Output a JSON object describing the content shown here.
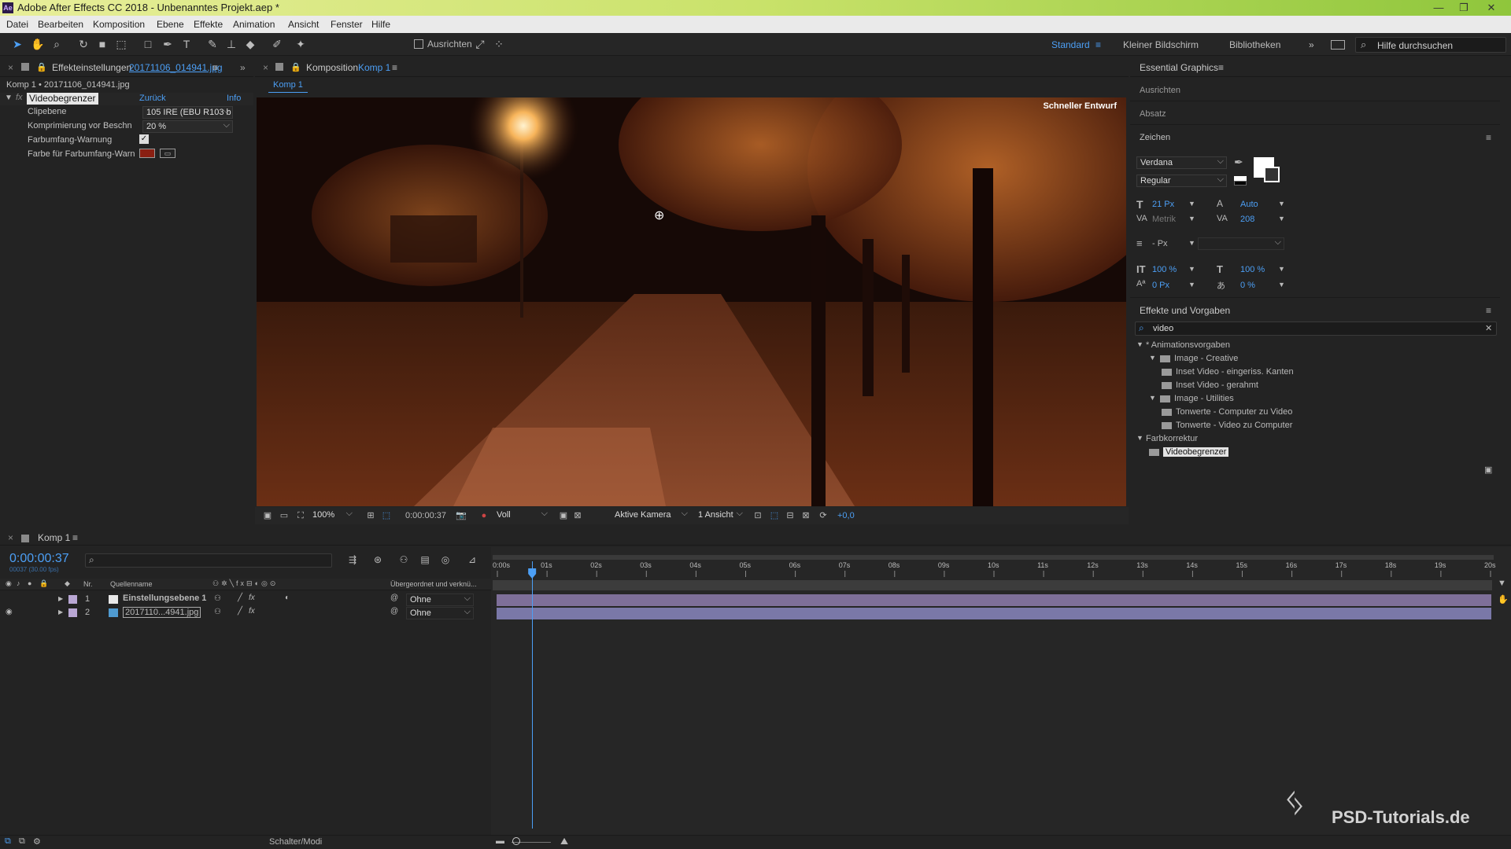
{
  "window": {
    "title": "Adobe After Effects CC 2018 - Unbenanntes Projekt.aep *",
    "app_badge": "Ae",
    "minimize": "—",
    "maximize": "❐",
    "close": "✕"
  },
  "menu": [
    "Datei",
    "Bearbeiten",
    "Komposition",
    "Ebene",
    "Effekte",
    "Animation",
    "Ansicht",
    "Fenster",
    "Hilfe"
  ],
  "toolbar": {
    "align_label": "Ausrichten",
    "workspaces": [
      "Standard",
      "Kleiner Bildschirm",
      "Bibliotheken"
    ],
    "active_workspace": "Standard",
    "more": "»",
    "help_search_placeholder": "Hilfe durchsuchen"
  },
  "effect_controls": {
    "tab_label": "Effekteinstellungen",
    "tab_file": "20171106_014941.jpg",
    "layer_path": "Komp 1 • 20171106_014941.jpg",
    "effect_name": "Videobegrenzer",
    "reset": "Zurück",
    "info": "Info",
    "props": [
      {
        "label": "Clipebene",
        "value": "105 IRE (EBU R103 b"
      },
      {
        "label": "Komprimierung vor Beschn",
        "value": "20 %"
      },
      {
        "label": "Farbumfang-Warnung",
        "value": "✓"
      },
      {
        "label": "Farbe für Farbumfang-Warn",
        "value": ""
      }
    ],
    "warn_color": "#8a1f12"
  },
  "composition": {
    "tab_label": "Komposition",
    "tab_comp": "Komp 1",
    "crumb": "Komp 1",
    "draft_label": "Schneller Entwurf",
    "zoom": "100%",
    "timecode": "0:00:00:37",
    "resolution": "Voll",
    "camera": "Aktive Kamera",
    "views": "1 Ansicht",
    "exposure": "+0,0"
  },
  "essential_graphics": {
    "title": "Essential Graphics",
    "sections": [
      "Ausrichten",
      "Absatz",
      "Zeichen"
    ]
  },
  "character": {
    "font": "Verdana",
    "style": "Regular",
    "size": "21 Px",
    "leading": "Auto",
    "kerning": "Metrik",
    "tracking": "208",
    "line_unit": "- Px",
    "vscale": "100 %",
    "hscale": "100 %",
    "baseline": "0 Px",
    "tsume": "0 %"
  },
  "effects_presets": {
    "title": "Effekte und Vorgaben",
    "search": "video",
    "tree": [
      {
        "label": "* Animationsvorgaben",
        "level": 0,
        "kind": "group"
      },
      {
        "label": "Image - Creative",
        "level": 1,
        "kind": "folder"
      },
      {
        "label": "Inset Video - eingeriss. Kanten",
        "level": 2,
        "kind": "item"
      },
      {
        "label": "Inset Video - gerahmt",
        "level": 2,
        "kind": "item"
      },
      {
        "label": "Image - Utilities",
        "level": 1,
        "kind": "folder"
      },
      {
        "label": "Tonwerte - Computer zu Video",
        "level": 2,
        "kind": "item"
      },
      {
        "label": "Tonwerte - Video zu Computer",
        "level": 2,
        "kind": "item"
      },
      {
        "label": "Farbkorrektur",
        "level": 0,
        "kind": "group"
      },
      {
        "label": "Videobegrenzer",
        "level": 1,
        "kind": "selected"
      }
    ]
  },
  "timeline": {
    "tab": "Komp 1",
    "timecode": "0:00:00:37",
    "sub_timecode": "00037 (30.00 fps)",
    "col_nr": "Nr.",
    "col_source": "Quellenname",
    "col_parent": "Übergeordnet und verknü...",
    "layers": [
      {
        "nr": "1",
        "name": "Einstellungsebene 1",
        "parent": "Ohne",
        "color": "#e8e8e8"
      },
      {
        "nr": "2",
        "name": "2017110...4941.jpg",
        "parent": "Ohne",
        "color": "#4f9ad0"
      }
    ],
    "ruler": [
      "0:00s",
      "01s",
      "02s",
      "03s",
      "04s",
      "05s",
      "06s",
      "07s",
      "08s",
      "09s",
      "10s",
      "11s",
      "12s",
      "13s",
      "14s",
      "15s",
      "16s",
      "17s",
      "18s",
      "19s",
      "20s"
    ],
    "playhead_seconds": 0.7,
    "switch_modes": "Schalter/Modi"
  },
  "watermark": {
    "text": "PSD-Tutorials.de"
  }
}
